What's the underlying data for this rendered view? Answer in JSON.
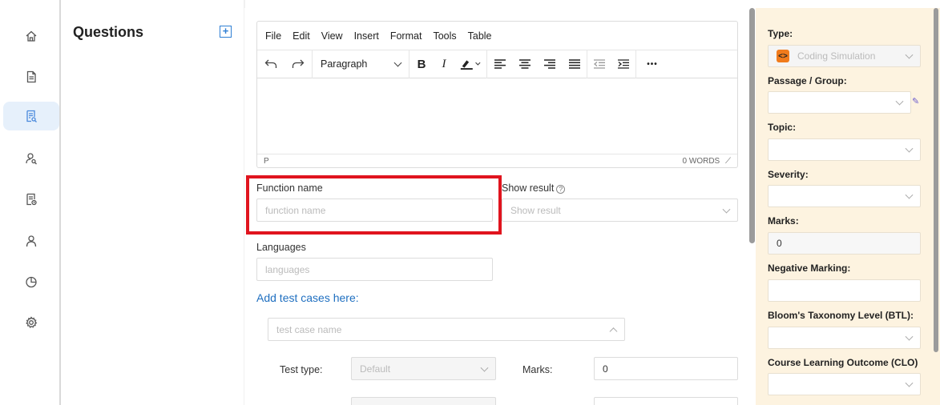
{
  "nav": {
    "items": [
      {
        "icon": "home-icon",
        "active": false
      },
      {
        "icon": "document-icon",
        "active": false
      },
      {
        "icon": "question-bank-icon",
        "active": true
      },
      {
        "icon": "user-search-icon",
        "active": false
      },
      {
        "icon": "report-icon",
        "active": false
      },
      {
        "icon": "user-icon",
        "active": false
      },
      {
        "icon": "pie-chart-icon",
        "active": false
      },
      {
        "icon": "settings-icon",
        "active": false
      }
    ]
  },
  "questions": {
    "title": "Questions",
    "add_label": "+"
  },
  "editor": {
    "menu": [
      "File",
      "Edit",
      "View",
      "Insert",
      "Format",
      "Tools",
      "Table"
    ],
    "paragraph_label": "Paragraph",
    "bold": "B",
    "italic": "I",
    "more": "•••",
    "status_left": "P",
    "status_right": "0 WORDS"
  },
  "form": {
    "function_name_label": "Function name",
    "function_name_placeholder": "function name",
    "show_result_label": "Show result",
    "show_result_placeholder": "Show result",
    "languages_label": "Languages",
    "languages_placeholder": "languages",
    "add_test_cases": "Add test cases here:",
    "test_case_placeholder": "test case name",
    "test_type_label": "Test type:",
    "test_type_value": "Default",
    "marks_label": "Marks:",
    "marks_value": "0",
    "help_glyph": "?"
  },
  "right_panel": {
    "type_label": "Type:",
    "type_value": "Coding Simulation",
    "type_icon_glyph": "<>",
    "passage_label": "Passage / Group:",
    "topic_label": "Topic:",
    "severity_label": "Severity:",
    "marks_label": "Marks:",
    "marks_value": "0",
    "negative_label": "Negative Marking:",
    "btl_label": "Bloom's Taxonomy Level (BTL):",
    "clo_label": "Course Learning Outcome (CLO)"
  },
  "colors": {
    "accent": "#1f6fc0",
    "highlight": "#e0141e",
    "panel_bg": "#fdf3e0",
    "type_icon": "#f07b1c"
  }
}
